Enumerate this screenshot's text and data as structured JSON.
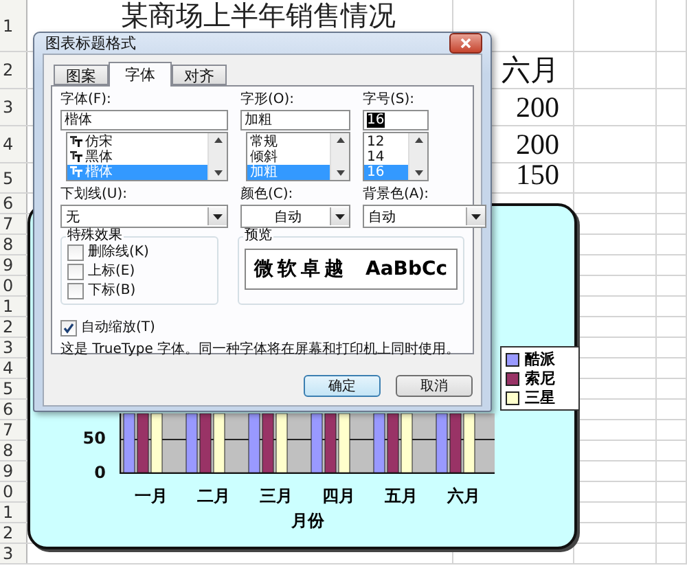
{
  "sheet": {
    "title": "某商场上半年销售情况",
    "row_numbers": [
      "1",
      "2",
      "3",
      "4",
      "5",
      "6",
      "7",
      "8",
      "9",
      "0",
      "1",
      "2",
      "3",
      "4",
      "5",
      "6",
      "7",
      "8",
      "9",
      "0",
      "1",
      "2",
      "3"
    ],
    "column_f": [
      "六月",
      "200",
      "200",
      "150"
    ]
  },
  "chart": {
    "legend": [
      {
        "label": "酷派",
        "color": "#9999ff"
      },
      {
        "label": "索尼",
        "color": "#993366"
      },
      {
        "label": "三星",
        "color": "#ffffcc"
      }
    ],
    "y_ticks": [
      "50",
      "0"
    ],
    "categories": [
      "一月",
      "二月",
      "三月",
      "四月",
      "五月",
      "六月"
    ],
    "x_axis_title": "月份"
  },
  "dialog": {
    "title": "图表标题格式",
    "tabs": [
      {
        "label": "图案",
        "selected": false
      },
      {
        "label": "字体",
        "selected": true
      },
      {
        "label": "对齐",
        "selected": false
      }
    ],
    "font": {
      "label": "字体(F):",
      "value": "楷体",
      "options": [
        {
          "label": "仿宋",
          "selected": false
        },
        {
          "label": "黑体",
          "selected": false
        },
        {
          "label": "楷体",
          "selected": true
        }
      ]
    },
    "style": {
      "label": "字形(O):",
      "value": "加粗",
      "options": [
        {
          "label": "常规",
          "selected": false
        },
        {
          "label": "倾斜",
          "selected": false
        },
        {
          "label": "加粗",
          "selected": true
        }
      ]
    },
    "size": {
      "label": "字号(S):",
      "value": "16",
      "options": [
        {
          "label": "12",
          "selected": false
        },
        {
          "label": "14",
          "selected": false
        },
        {
          "label": "16",
          "selected": true
        }
      ]
    },
    "underline": {
      "label": "下划线(U):",
      "value": "无"
    },
    "color": {
      "label": "颜色(C):",
      "value": "自动"
    },
    "background": {
      "label": "背景色(A):",
      "value": "自动"
    },
    "effects": {
      "title": "特殊效果",
      "items": [
        {
          "label": "删除线(K)",
          "checked": false
        },
        {
          "label": "上标(E)",
          "checked": false
        },
        {
          "label": "下标(B)",
          "checked": false
        }
      ]
    },
    "preview": {
      "title": "预览",
      "samples": [
        "微软卓越",
        "AaBbCc"
      ]
    },
    "auto_scale": {
      "label": "自动缩放(T)",
      "checked": true
    },
    "note": "这是 TrueType 字体。同一种字体将在屏幕和打印机上同时使用。",
    "buttons": [
      {
        "label": "确定",
        "default": true
      },
      {
        "label": "取消",
        "default": false
      }
    ]
  }
}
